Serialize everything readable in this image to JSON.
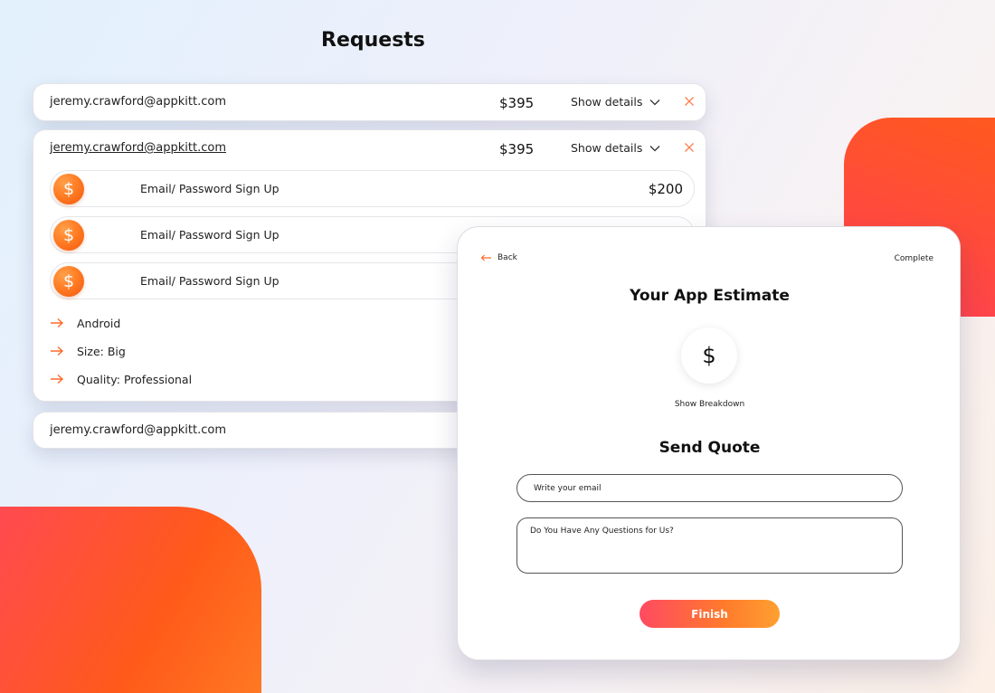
{
  "page": {
    "title": "Requests"
  },
  "requests": [
    {
      "email": "jeremy.crawford@appkitt.com",
      "price": "$395",
      "show_details": "Show details"
    },
    {
      "email": "jeremy.crawford@appkitt.com",
      "price": "$395",
      "show_details": "Show details",
      "items": [
        {
          "label": "Email/ Password Sign Up",
          "price": "$200"
        },
        {
          "label": "Email/ Password Sign Up",
          "price": ""
        },
        {
          "label": "Email/ Password Sign Up",
          "price": ""
        }
      ],
      "features": [
        "Android",
        "Size: Big",
        "Quality: Professional"
      ]
    },
    {
      "email": "jeremy.crawford@appkitt.com"
    }
  ],
  "estimate": {
    "back_label": "Back",
    "complete_label": "Complete",
    "title": "Your App Estimate",
    "currency_symbol": "$",
    "breakdown_label": "Show Breakdown",
    "quote_title": "Send Quote",
    "email_placeholder": "Write your email",
    "questions_placeholder": "Do You Have Any Questions for Us?",
    "finish_label": "Finish"
  },
  "colors": {
    "accent": "#ff6a2a",
    "gradient_start": "#ff4a62",
    "gradient_end": "#ffa030"
  },
  "icons": {
    "coin": "dollar-coin-icon",
    "chevron": "chevron-down-icon",
    "close": "close-icon",
    "arrow": "arrow-right-icon",
    "back": "arrow-left-icon"
  }
}
